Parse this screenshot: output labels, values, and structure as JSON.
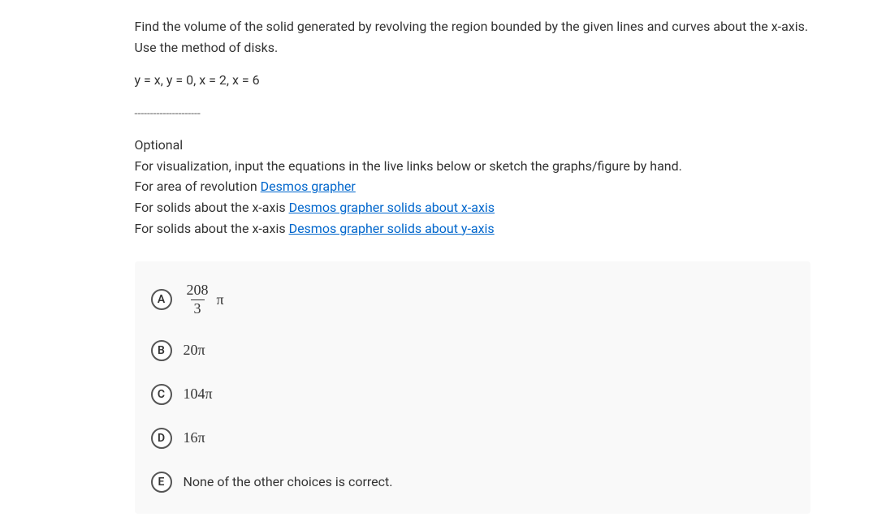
{
  "question": {
    "prompt": "Find the volume of the solid generated by revolving the region bounded by the given lines and curves about the x-axis. Use the method of disks.",
    "equation": "y = x, y = 0, x = 2, x = 6",
    "dashes": "---------------------"
  },
  "optional": {
    "heading": "Optional",
    "intro": "For visualization, input the equations in the live links below or sketch the graphs/figure by hand.",
    "line1_prefix": "For area of revolution ",
    "line1_link": "Desmos grapher",
    "line2_prefix": "For solids about the x-axis ",
    "line2_link": "Desmos grapher solids about x-axis",
    "line3_prefix": "For solids about the x-axis ",
    "line3_link": "Desmos grapher solids about y-axis"
  },
  "options": {
    "a": {
      "letter": "A",
      "numerator": "208",
      "denominator": "3",
      "pi": "π"
    },
    "b": {
      "letter": "B",
      "text": "20π"
    },
    "c": {
      "letter": "C",
      "text": "104π"
    },
    "d": {
      "letter": "D",
      "text": "16π"
    },
    "e": {
      "letter": "E",
      "text": "None of the other choices is correct."
    }
  }
}
